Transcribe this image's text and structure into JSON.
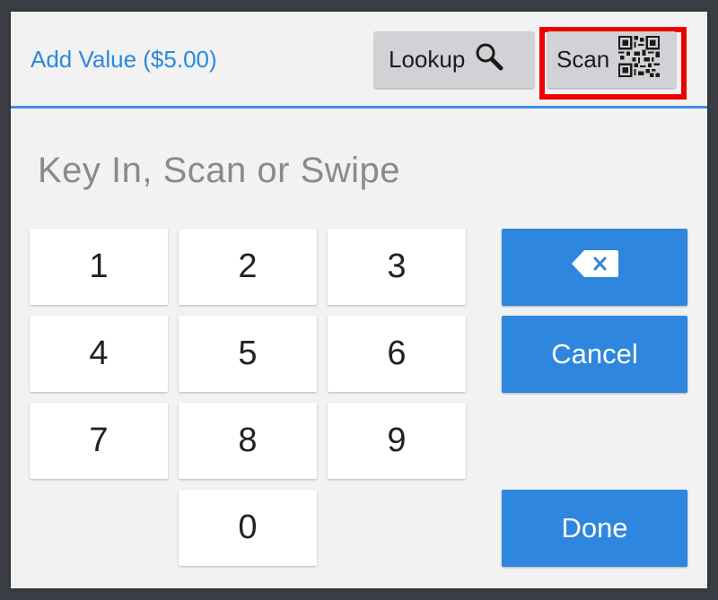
{
  "header": {
    "title": "Add Value ($5.00)",
    "lookup_label": "Lookup",
    "lookup_icon": "search-icon",
    "scan_label": "Scan",
    "scan_icon": "qr-code-icon"
  },
  "prompt": "Key In, Scan or Swipe",
  "keypad": [
    "1",
    "2",
    "3",
    "4",
    "5",
    "6",
    "7",
    "8",
    "9",
    "0"
  ],
  "actions": {
    "backspace_icon": "backspace-icon",
    "cancel_label": "Cancel",
    "done_label": "Done"
  },
  "colors": {
    "accent": "#2e86de",
    "highlight": "#ee0000"
  }
}
